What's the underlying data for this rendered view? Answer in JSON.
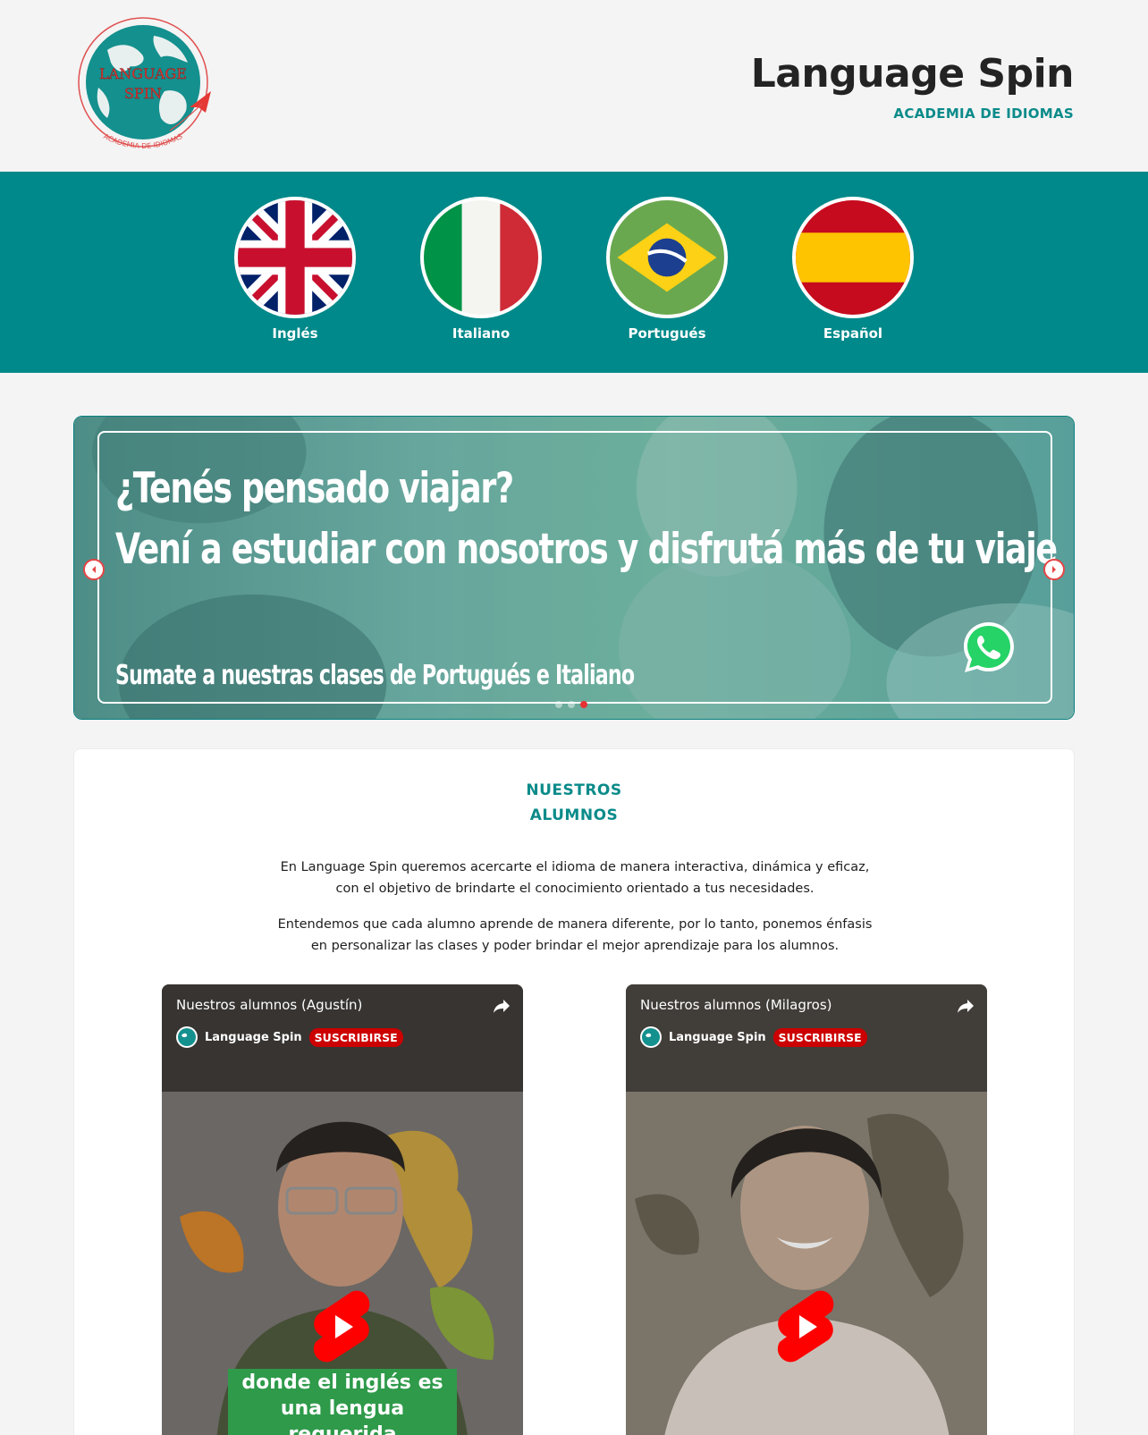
{
  "header": {
    "logo_text_line1": "LANGUAGE",
    "logo_text_line2": "SPIN",
    "logo_arc_text": "ACADEMIA DE IDIOMAS",
    "title": "Language Spin",
    "subtitle": "ACADEMIA DE IDIOMAS"
  },
  "languages": [
    {
      "label": "Inglés",
      "flag": "uk-flag-icon"
    },
    {
      "label": "Italiano",
      "flag": "italy-flag-icon"
    },
    {
      "label": "Portugués",
      "flag": "brazil-flag-icon"
    },
    {
      "label": "Español",
      "flag": "spain-flag-icon"
    }
  ],
  "carousel": {
    "headline_line1": "¿Tenés pensado viajar?",
    "headline_line2": "Vení a estudiar con nosotros y disfrutá más de tu viaje",
    "subline": "Sumate a nuestras clases de Portugués e Italiano",
    "slide_count": 3,
    "active_slide": 3
  },
  "students": {
    "title_line1": "NUESTROS",
    "title_line2": "ALUMNOS",
    "paragraph1": "En Language Spin queremos acercarte el idioma de manera interactiva, dinámica y eficaz, con el objetivo de brindarte el conocimiento orientado a tus necesidades.",
    "paragraph2": "Entendemos que cada alumno aprende de manera diferente, por lo tanto, ponemos énfasis en personalizar las clases y poder brindar el mejor aprendizaje para los alumnos.",
    "videos": [
      {
        "title": "Nuestros alumnos (Agustín)",
        "channel": "Language Spin",
        "subscribe": "SUSCRIBIRSE",
        "caption_line1": "donde el inglés es",
        "caption_line2": "una lengua requerida"
      },
      {
        "title": "Nuestros alumnos (Milagros)",
        "channel": "Language Spin",
        "subscribe": "SUSCRIBIRSE"
      }
    ]
  },
  "colors": {
    "teal": "#00898a",
    "accent_red": "#e63232",
    "youtube_red": "#cc0000",
    "background": "#f4f4f4"
  }
}
